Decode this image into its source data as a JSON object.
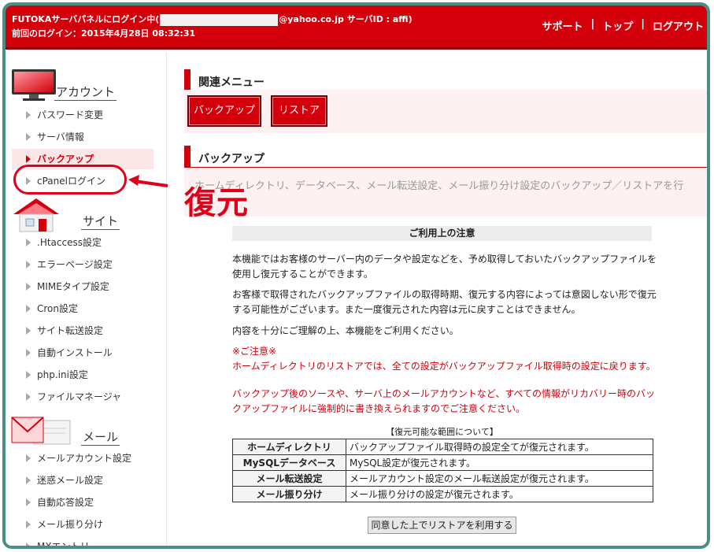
{
  "header": {
    "login_prefix": "FUTOKAサーバパネルにログイン中(",
    "login_suffix": "@yahoo.co.jp サーバID : affi)",
    "last_login": "前回のログイン：2015年4月28日 08:32:31",
    "nav": [
      "サポート",
      "トップ",
      "ログアウト"
    ],
    "nav_separator": "|",
    "color": "#d3000c"
  },
  "sidebar": {
    "account": {
      "label": "アカウント",
      "items": [
        "パスワード変更",
        "サーバ情報",
        "バックアップ",
        "cPanelログイン"
      ]
    },
    "site": {
      "label": "サイト",
      "items": [
        ".Htaccess設定",
        "エラーページ設定",
        "MIMEタイプ設定",
        "Cron設定",
        "サイト転送設定",
        "自動インストール",
        "php.ini設定",
        "ファイルマネージャ"
      ]
    },
    "mail": {
      "label": "メール",
      "items": [
        "メールアカウント設定",
        "迷惑メール設定",
        "自動応答設定",
        "メール振り分け",
        "MXエントリー"
      ]
    },
    "active_item": "バックアップ"
  },
  "annotation": {
    "text": "復元",
    "color": "#e0001a"
  },
  "main": {
    "related_menu_title": "関連メニュー",
    "buttons": [
      "バックアップ",
      "リストア"
    ],
    "backup_title": "バックアップ",
    "description": "ホームディレクトリ、データベース、メール転送設定、メール振り分け設定のバックアップ／リストアを行",
    "notice_title": "ご利用上の注意",
    "paragraphs": [
      "本機能ではお客様のサーバー内のデータや設定などを、予め取得しておいたバックアップファイルを使用し復元することができます。",
      "お客様で取得されたバックアップファイルの取得時期、復元する内容によっては意図しない形で復元する可能性がございます。また一度復元された内容は元に戻すことはできません。",
      "内容を十分にご理解の上、本機能をご利用ください。"
    ],
    "caution_heading": "※ご注意※",
    "caution_lines": [
      "ホームディレクトリのリストアでは、全ての設定がバックアップファイル取得時の設定に戻ります。",
      "バックアップ後のソースや、サーバ上のメールアカウントなど、すべての情報がリカバリー時のバックアップファイルに強制的に書き換えられますのでご注意ください。"
    ],
    "range_title": "【復元可能な範囲について】",
    "range_rows": [
      {
        "name": "ホームディレクトリ",
        "desc": "バックアップファイル取得時の設定全てが復元されます。"
      },
      {
        "name": "MySQLデータベース",
        "desc": "MySQL設定が復元されます。"
      },
      {
        "name": "メール転送設定",
        "desc": "メールアカウント設定のメール転送設定が復元されます。"
      },
      {
        "name": "メール振り分け",
        "desc": "メール振り分けの設定が復元されます。"
      }
    ],
    "agree_button": "同意した上でリストアを利用する"
  }
}
